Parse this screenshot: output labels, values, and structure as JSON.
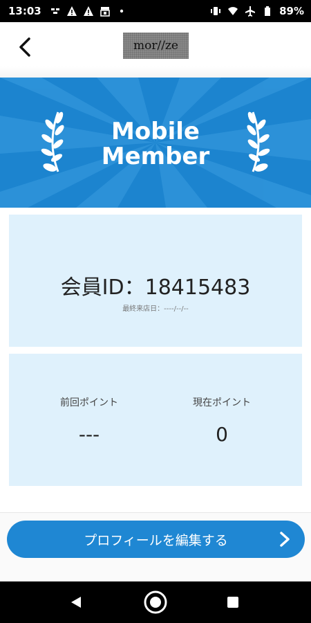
{
  "status_bar": {
    "time": "13:03",
    "left_icons": [
      "network-icon",
      "warning-icon",
      "warning-icon",
      "store-icon",
      "dot-icon"
    ],
    "right_icons": [
      "vibrate-icon",
      "wifi-icon",
      "airplane-icon",
      "battery-icon"
    ],
    "battery": "89%"
  },
  "header": {
    "logo_text": "mor//ze"
  },
  "banner": {
    "line1": "Mobile",
    "line2": "Member",
    "color": "#1c84cf"
  },
  "member": {
    "id_label": "会員ID：18415483",
    "last_visit": "最終来店日：----/--/--"
  },
  "points": {
    "previous_label": "前回ポイント",
    "previous_value": "---",
    "current_label": "現在ポイント",
    "current_value": "0"
  },
  "actions": {
    "edit_profile": "プロフィールを編集する"
  },
  "colors": {
    "accent": "#1f87d3",
    "card_bg": "#dff1fc"
  }
}
